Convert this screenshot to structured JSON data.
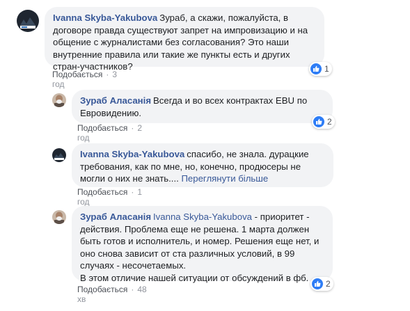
{
  "comments": [
    {
      "author": "Ivanna Skyba-Yakubova",
      "text": "Зураб, а скажи, пожалуйста, в договоре правда существуют запрет на импровизацию и на общение с журналистами без согласования? Это наши внутренние правила или такие же пункты есть и других стран-участников?",
      "like_label": "Подобається",
      "time": "3 год",
      "reactions": "1"
    },
    {
      "author": "Зураб Аласанія",
      "text": "Всегда и во всех контрактах EBU по Евровидению.",
      "like_label": "Подобається",
      "time": "2 год",
      "reactions": "2"
    },
    {
      "author": "Ivanna Skyba-Yakubova",
      "text": "спасибо, не знала. дурацкие требования, как по мне, но, конечно, продюсеры не могли о них не знать....",
      "see_more": "Переглянути більше",
      "like_label": "Подобається",
      "time": "1 год"
    },
    {
      "author": "Зураб Аласанія",
      "mention": "Ivanna Skyba-Yakubova",
      "text": "- приоритет - действия. Проблема еще не решена. 1 марта должен быть готов и исполнитель, и номер. Решения еще нет, и оно снова зависит от ста различных условий, в 99 случаях - несочетаемых.",
      "text2": "В этом отличие нашей ситуации от обсуждений в фб.",
      "like_label": "Подобається",
      "time": "48 хв",
      "reactions": "2"
    }
  ],
  "icons": {
    "like": "thumbs-up-icon",
    "avatar_ivanna": "avatar-ivanna",
    "avatar_zurab": "avatar-zurab"
  },
  "colors": {
    "link": "#385898",
    "bubble": "#f2f3f5",
    "like_blue": "#2e7df6"
  }
}
